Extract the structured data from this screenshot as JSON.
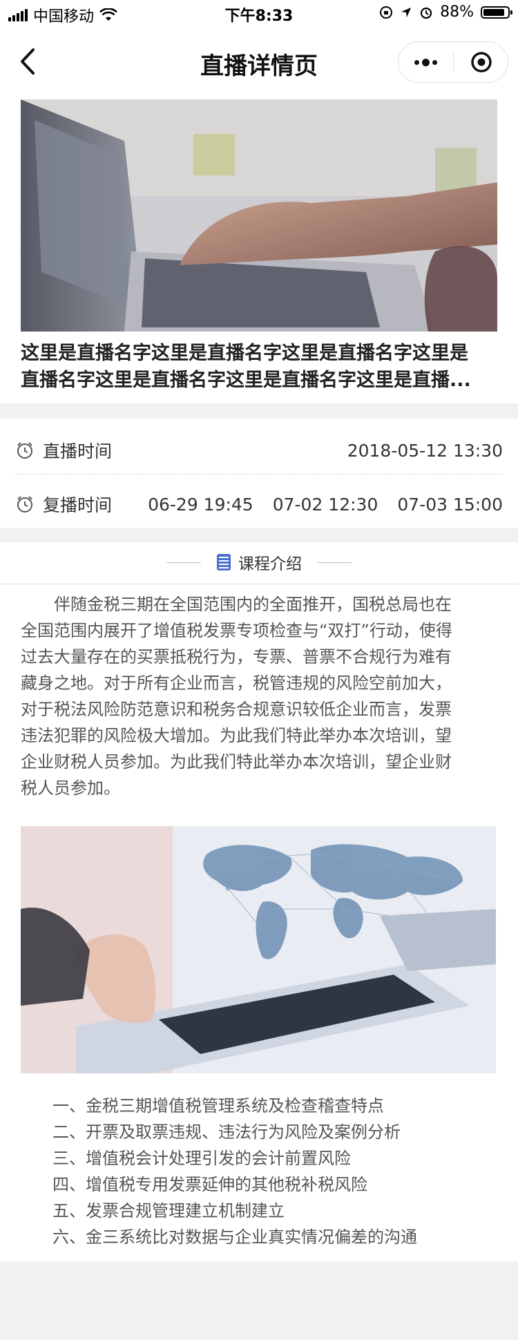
{
  "status_bar": {
    "carrier": "中国移动",
    "time": "下午8:33",
    "battery": "88%"
  },
  "nav": {
    "title": "直播详情页",
    "back_icon": "chevron-left-icon",
    "more_icon": "more-dots-icon",
    "close_icon": "record-circle-icon"
  },
  "live": {
    "title_line1": "这里是直播名字这里是直播名字这里是直播名字这里是",
    "title_line2": "直播名字这里是直播名字这里是直播名字这里是直播..."
  },
  "schedule": {
    "live_label": "直播时间",
    "live_time": "2018-05-12 13:30",
    "replay_label": "复播时间",
    "replay_times": [
      "06-29 19:45",
      "07-02 12:30",
      "07-03 15:00"
    ],
    "icon": "alarm-clock-icon"
  },
  "course": {
    "heading": "课程介绍",
    "heading_icon": "book-icon",
    "intro_lines": [
      "　　伴随金税三期在全国范围内的全面推开，国税总局也在",
      "全国范围内展开了增值税发票专项检查与“双打”行动，使得",
      "过去大量存在的买票抵税行为，专票、普票不合规行为难有",
      "藏身之地。对于所有企业而言，税管违规的风险空前加大，",
      "对于税法风险防范意识和税务合规意识较低企业而言，发票",
      "违法犯罪的风险极大增加。为此我们特此举办本次培训，望",
      "企业财税人员参加。为此我们特此举办本次培训，望企业财",
      "税人员参加。"
    ],
    "outline": [
      "一、金税三期增值税管理系统及检查稽查特点",
      "二、开票及取票违规、违法行为风险及案例分析",
      "三、增值税会计处理引发的会计前置风险",
      "四、增值税专用发票延伸的其他税补税风险",
      "五、发票合规管理建立机制建立",
      "六、金三系统比对数据与企业真实情况偏差的沟通"
    ]
  },
  "colors": {
    "accent_icon": "#4a6fd1",
    "page_bg": "#f1f1f3"
  }
}
